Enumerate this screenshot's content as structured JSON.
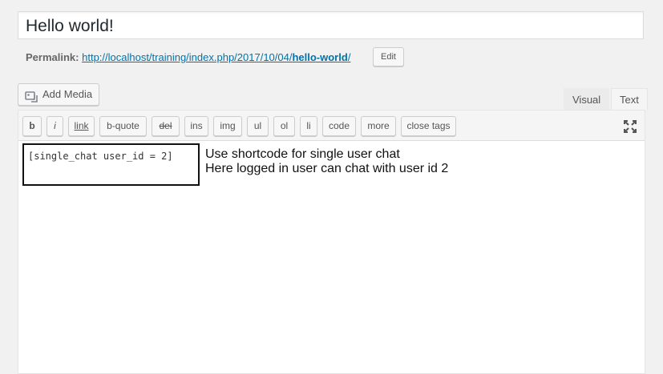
{
  "post": {
    "title": "Hello world!"
  },
  "permalink": {
    "label": "Permalink:",
    "url_base": "http://localhost/training/index.php/2017/10/04/",
    "slug": "hello-world",
    "url_tail": "/",
    "edit_label": "Edit"
  },
  "media": {
    "add_label": "Add Media",
    "icon": "media-icon"
  },
  "tabs": [
    {
      "label": "Visual",
      "active": false
    },
    {
      "label": "Text",
      "active": true
    }
  ],
  "quicktags": [
    "b",
    "i",
    "link",
    "b-quote",
    "del",
    "ins",
    "img",
    "ul",
    "ol",
    "li",
    "code",
    "more",
    "close tags"
  ],
  "content": {
    "shortcode": "[single_chat user_id = 2]",
    "note_line1": "Use shortcode for single user chat",
    "note_line2": "Here logged in user can chat with user id 2"
  }
}
